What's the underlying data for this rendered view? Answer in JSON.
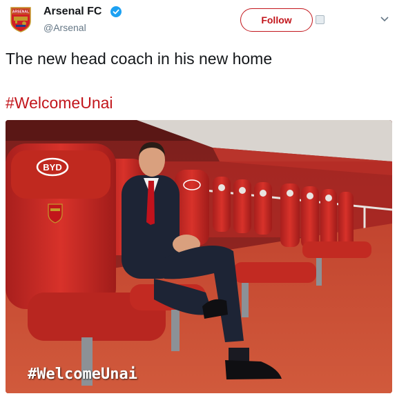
{
  "account": {
    "display_name": "Arsenal FC",
    "handle": "@Arsenal",
    "verified": true,
    "avatar_icon": "arsenal-crest-icon"
  },
  "actions": {
    "follow_label": "Follow",
    "menu_icon": "chevron-down-icon"
  },
  "tweet": {
    "text": "The new head coach in his new home",
    "hashtag": "#WelcomeUnai"
  },
  "media": {
    "seat_brand": "BYD",
    "overlay_text": "#WelcomeUnai"
  },
  "colors": {
    "brand_red": "#c2151b",
    "verified_blue": "#1da1f2",
    "handle_gray": "#657786"
  }
}
